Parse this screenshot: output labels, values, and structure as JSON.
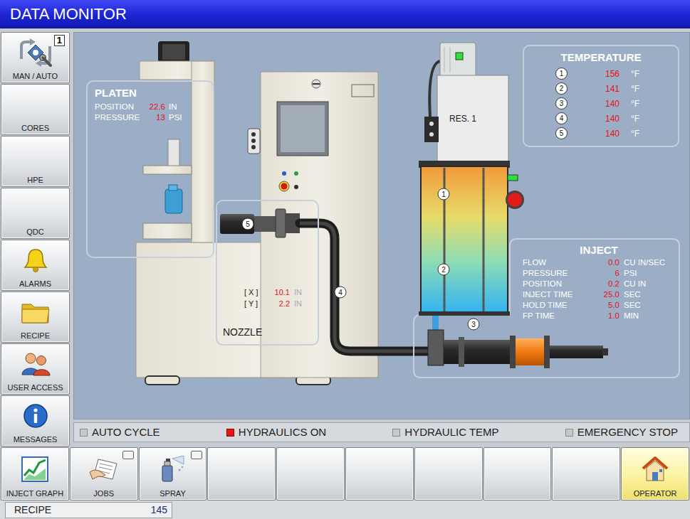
{
  "window": {
    "title": "DATA MONITOR"
  },
  "sidebar": {
    "items": [
      {
        "label": "MAN / AUTO",
        "badge": "1"
      },
      {
        "label": "CORES"
      },
      {
        "label": "HPE"
      },
      {
        "label": "QDC"
      },
      {
        "label": "ALARMS"
      },
      {
        "label": "RECIPE"
      },
      {
        "label": "USER ACCESS"
      },
      {
        "label": "MESSAGES"
      }
    ]
  },
  "platen": {
    "title": "PLATEN",
    "rows": [
      {
        "label": "POSITION",
        "value": "22.6",
        "unit": "IN"
      },
      {
        "label": "PRESSURE",
        "value": "13",
        "unit": "PSI"
      }
    ]
  },
  "temperature": {
    "title": "TEMPERATURE",
    "rows": [
      {
        "number": "1",
        "value": "156",
        "unit": "°F"
      },
      {
        "number": "2",
        "value": "141",
        "unit": "°F"
      },
      {
        "number": "3",
        "value": "140",
        "unit": "°F"
      },
      {
        "number": "4",
        "value": "140",
        "unit": "°F"
      },
      {
        "number": "5",
        "value": "140",
        "unit": "°F"
      }
    ]
  },
  "inject": {
    "title": "INJECT",
    "rows": [
      {
        "label": "FLOW",
        "value": "0.0",
        "unit": "CU IN/SEC"
      },
      {
        "label": "PRESSURE",
        "value": "6",
        "unit": "PSI"
      },
      {
        "label": "POSITION",
        "value": "0.2",
        "unit": "CU IN"
      },
      {
        "label": "INJECT TIME",
        "value": "25.0",
        "unit": "SEC"
      },
      {
        "label": "HOLD TIME",
        "value": "5.0",
        "unit": "SEC"
      },
      {
        "label": "FP TIME",
        "value": "1.0",
        "unit": "MIN"
      }
    ]
  },
  "nozzle": {
    "title": "NOZZLE",
    "axes": [
      {
        "label": "[ X ]",
        "value": "10.1",
        "unit": "IN",
        "unit_greyed": true
      },
      {
        "label": "[ Y ]",
        "value": "2.2",
        "unit": "IN",
        "unit_greyed": true
      }
    ]
  },
  "diagram": {
    "markers": [
      {
        "label": "1"
      },
      {
        "label": "2"
      },
      {
        "label": "3"
      },
      {
        "label": "4"
      },
      {
        "label": "5"
      }
    ],
    "resin_label": "RES. 1",
    "motor_lamp_on": true,
    "tank_lamp_on": true
  },
  "status_bar": [
    {
      "label": "AUTO CYCLE",
      "on": false
    },
    {
      "label": "HYDRAULICS ON",
      "on": true
    },
    {
      "label": "HYDRAULIC TEMP",
      "on": false
    },
    {
      "label": "EMERGENCY STOP",
      "on": false
    }
  ],
  "toolbar": {
    "buttons": [
      {
        "kind": "labeled",
        "label": "INJECT GRAPH",
        "selected": false
      },
      {
        "kind": "labeled",
        "label": "JOBS",
        "selected": false,
        "indicator": false
      },
      {
        "kind": "labeled",
        "label": "SPRAY",
        "selected": false,
        "indicator": false
      },
      {
        "kind": "blank",
        "selected": false
      },
      {
        "kind": "blank",
        "selected": false
      },
      {
        "kind": "blank",
        "selected": false
      },
      {
        "kind": "blank",
        "selected": false
      },
      {
        "kind": "blank",
        "selected": false
      },
      {
        "kind": "blank",
        "selected": false
      },
      {
        "kind": "labeled",
        "label": "OPERATOR",
        "selected": true
      }
    ]
  },
  "footer": {
    "label": "RECIPE",
    "value": "145"
  }
}
